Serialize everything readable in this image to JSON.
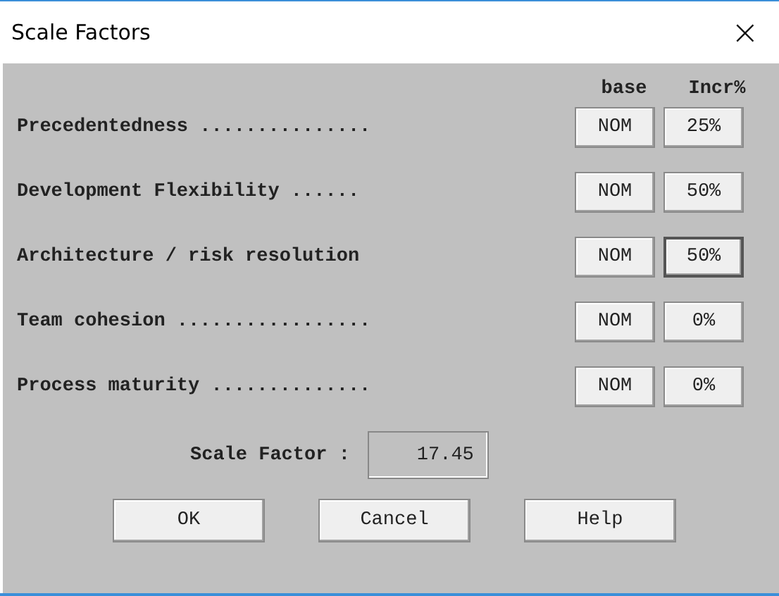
{
  "window": {
    "title": "Scale Factors",
    "close": "×"
  },
  "columns": [
    "base",
    "Incr%"
  ],
  "factors": [
    {
      "label": "Precedentedness ...............",
      "base": "NOM",
      "incr": "25%",
      "focused": false
    },
    {
      "label": "Development Flexibility ......",
      "base": "NOM",
      "incr": "50%",
      "focused": false
    },
    {
      "label": "Architecture / risk resolution",
      "base": "NOM",
      "incr": "50%",
      "focused": true
    },
    {
      "label": "Team cohesion .................",
      "base": "NOM",
      "incr": "0%",
      "focused": false
    },
    {
      "label": "Process maturity ..............",
      "base": "NOM",
      "incr": "0%",
      "focused": false
    }
  ],
  "result": {
    "label": "Scale Factor :",
    "value": "17.45"
  },
  "buttons": [
    "OK",
    "Cancel",
    "Help"
  ]
}
